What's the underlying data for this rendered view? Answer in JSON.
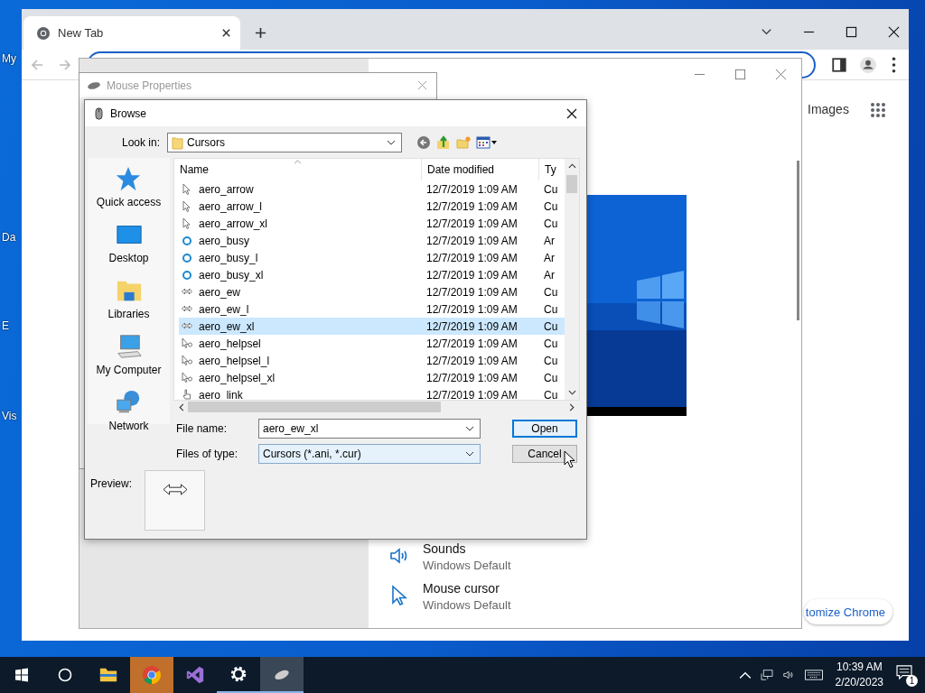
{
  "desktop": {
    "icon_labels": [
      "My",
      "Da",
      "E",
      "Vis"
    ]
  },
  "browser": {
    "tabs": [
      {
        "title": "New Tab",
        "selected": true
      }
    ],
    "images_link": "Images",
    "customize_button": "tomize Chrome"
  },
  "settings_window": {
    "items": [
      {
        "title": "Sounds",
        "value": "Windows Default",
        "kind": "sound"
      },
      {
        "title": "Mouse cursor",
        "value": "Windows Default",
        "kind": "pointer"
      }
    ]
  },
  "mouse_properties": {
    "title": "Mouse Properties"
  },
  "browse_dialog": {
    "title": "Browse",
    "look_in_label": "Look in:",
    "look_in": "Cursors",
    "places": [
      {
        "label": "Quick access",
        "kind": "star"
      },
      {
        "label": "Desktop",
        "kind": "desktop"
      },
      {
        "label": "Libraries",
        "kind": "libraries"
      },
      {
        "label": "My Computer",
        "kind": "computer"
      },
      {
        "label": "Network",
        "kind": "network"
      }
    ],
    "columns": [
      "Name",
      "Date modified",
      "Ty"
    ],
    "files": [
      {
        "name": "aero_arrow",
        "date": "12/7/2019 1:09 AM",
        "type": "Cu",
        "kind": "arrow",
        "selected": false
      },
      {
        "name": "aero_arrow_l",
        "date": "12/7/2019 1:09 AM",
        "type": "Cu",
        "kind": "arrow",
        "selected": false
      },
      {
        "name": "aero_arrow_xl",
        "date": "12/7/2019 1:09 AM",
        "type": "Cu",
        "kind": "arrow",
        "selected": false
      },
      {
        "name": "aero_busy",
        "date": "12/7/2019 1:09 AM",
        "type": "Ar",
        "kind": "busy",
        "selected": false
      },
      {
        "name": "aero_busy_l",
        "date": "12/7/2019 1:09 AM",
        "type": "Ar",
        "kind": "busy",
        "selected": false
      },
      {
        "name": "aero_busy_xl",
        "date": "12/7/2019 1:09 AM",
        "type": "Ar",
        "kind": "busy",
        "selected": false
      },
      {
        "name": "aero_ew",
        "date": "12/7/2019 1:09 AM",
        "type": "Cu",
        "kind": "ew",
        "selected": false
      },
      {
        "name": "aero_ew_l",
        "date": "12/7/2019 1:09 AM",
        "type": "Cu",
        "kind": "ew",
        "selected": false
      },
      {
        "name": "aero_ew_xl",
        "date": "12/7/2019 1:09 AM",
        "type": "Cu",
        "kind": "ew",
        "selected": true
      },
      {
        "name": "aero_helpsel",
        "date": "12/7/2019 1:09 AM",
        "type": "Cu",
        "kind": "helpsel",
        "selected": false
      },
      {
        "name": "aero_helpsel_l",
        "date": "12/7/2019 1:09 AM",
        "type": "Cu",
        "kind": "helpsel",
        "selected": false
      },
      {
        "name": "aero_helpsel_xl",
        "date": "12/7/2019 1:09 AM",
        "type": "Cu",
        "kind": "helpsel",
        "selected": false
      },
      {
        "name": "aero_link",
        "date": "12/7/2019 1:09 AM",
        "type": "Cu",
        "kind": "link",
        "selected": false
      }
    ],
    "file_name_label": "File name:",
    "file_name": "aero_ew_xl",
    "file_type_label": "Files of type:",
    "file_type": "Cursors (*.ani, *.cur)",
    "buttons": [
      {
        "label": "Open",
        "default": true
      },
      {
        "label": "Cancel",
        "default": false
      }
    ],
    "preview_label": "Preview:"
  },
  "taskbar": {
    "apps": [
      {
        "kind": "explorer",
        "running": false,
        "selected": false,
        "attention": false
      },
      {
        "kind": "chrome",
        "running": false,
        "selected": false,
        "attention": true
      },
      {
        "kind": "visual-studio",
        "running": false,
        "selected": false,
        "attention": false
      },
      {
        "kind": "settings",
        "running": true,
        "selected": false,
        "attention": false
      },
      {
        "kind": "mouse",
        "running": true,
        "selected": true,
        "attention": false
      }
    ],
    "time": "10:39 AM",
    "date": "2/20/2023",
    "notification_count": "1"
  }
}
